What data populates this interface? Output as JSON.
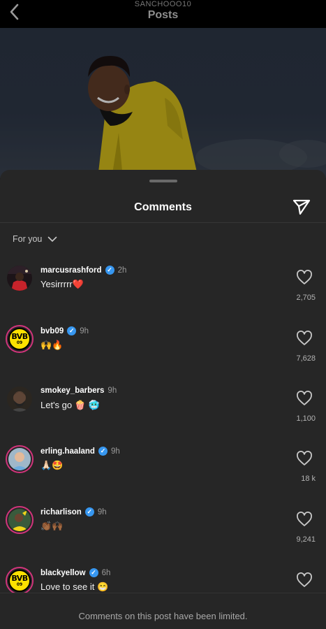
{
  "header": {
    "username": "SANCHOOO10",
    "title": "Posts"
  },
  "sheet": {
    "title": "Comments",
    "sort_label": "For you"
  },
  "comments": [
    {
      "user": "marcusrashford",
      "verified": true,
      "time": "2h",
      "text": "Yesirrrrr❤️",
      "likes": "2,705"
    },
    {
      "user": "bvb09",
      "verified": true,
      "time": "9h",
      "text": "🙌🔥",
      "likes": "7,628"
    },
    {
      "user": "smokey_barbers",
      "verified": false,
      "time": "9h",
      "text": "Let's go 🍿 🥶",
      "likes": "1,100"
    },
    {
      "user": "erling.haaland",
      "verified": true,
      "time": "9h",
      "text": "🙏🏻🤩",
      "likes": "18 k"
    },
    {
      "user": "richarlison",
      "verified": true,
      "time": "9h",
      "text": "👏🏾🙌🏾",
      "likes": "9,241"
    },
    {
      "user": "blackyellow",
      "verified": true,
      "time": "6h",
      "text": "Love to see it 😁",
      "likes": ""
    }
  ],
  "avatars": {
    "bvb_line1": "BVB",
    "bvb_line2": "09"
  },
  "footer": {
    "message": "Comments on this post have been limited."
  },
  "colors": {
    "background": "#000000",
    "sheet": "#262626",
    "verified": "#3797f0",
    "story_ring": "#d1347b",
    "bvb_yellow": "#fde100"
  }
}
